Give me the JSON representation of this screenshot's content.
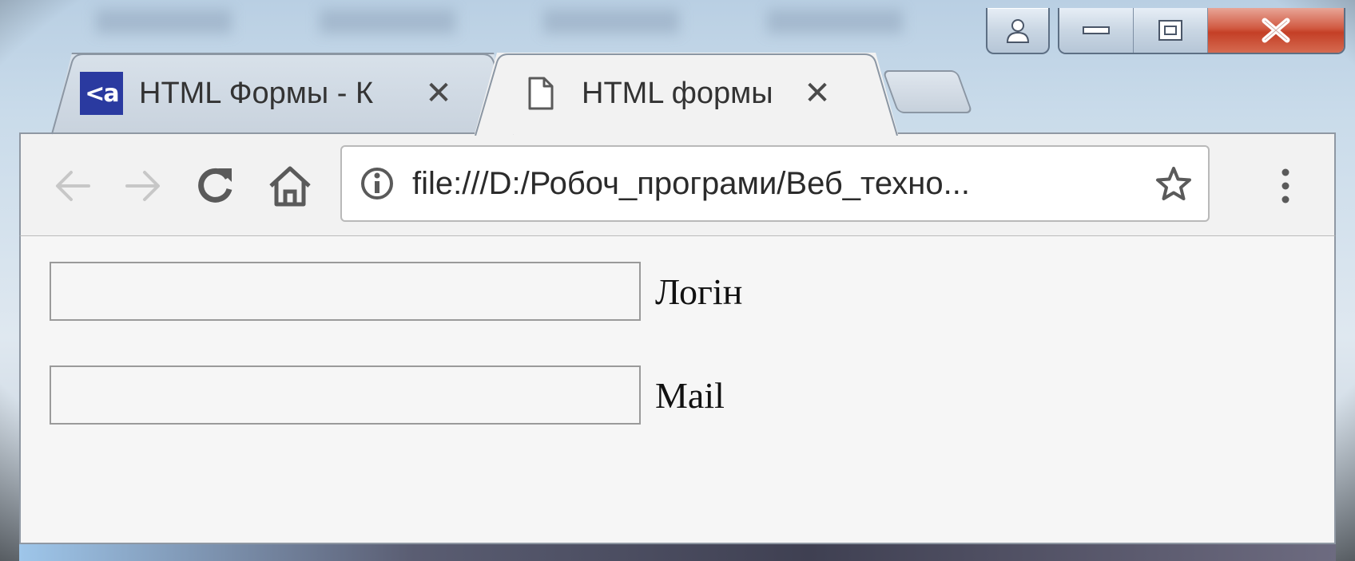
{
  "window": {
    "controls": [
      "user",
      "minimize",
      "maximize",
      "close"
    ]
  },
  "tabs": [
    {
      "title": "HTML Формы - К",
      "favicon": "<a",
      "active": false
    },
    {
      "title": "HTML формы",
      "favicon": "page-icon",
      "active": true
    }
  ],
  "toolbar": {
    "url": "file:///D:/Робоч_програми/Веб_техно..."
  },
  "form": {
    "fields": [
      {
        "label": "Логін",
        "value": ""
      },
      {
        "label": "Mail",
        "value": ""
      }
    ]
  }
}
